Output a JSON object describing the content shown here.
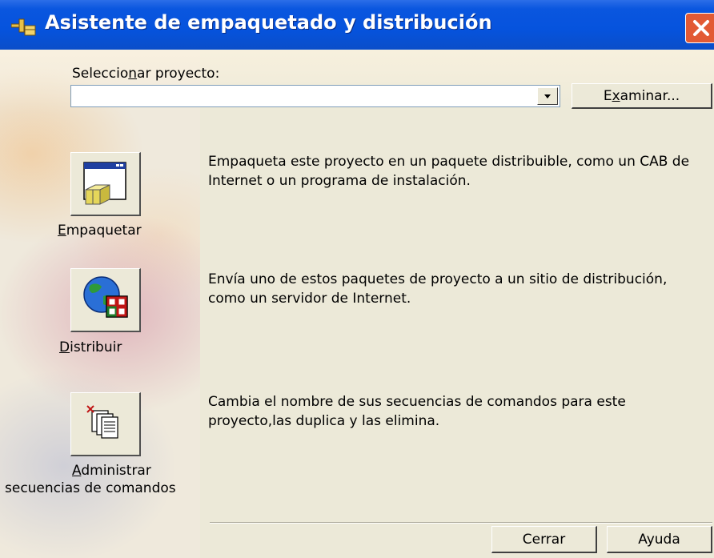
{
  "window": {
    "title": "Asistente de empaquetado y distribución",
    "close_icon": "close-icon",
    "accent_color": "#0653dd",
    "close_color": "#e25a34"
  },
  "project": {
    "label_pre": "Seleccio",
    "label_mnemonic": "n",
    "label_post": "ar proyecto:",
    "value": "",
    "browse_pre": "E",
    "browse_mnemonic": "x",
    "browse_post": "aminar..."
  },
  "actions": [
    {
      "icon": "package-icon",
      "caption_mnemonic": "E",
      "caption_post": "mpaquetar",
      "description": "Empaqueta este proyecto en un paquete distribuible, como un CAB de Internet o un programa de instalación."
    },
    {
      "icon": "globe-icon",
      "caption_mnemonic": "D",
      "caption_post": "istribuir",
      "description": "Envía uno de estos paquetes de proyecto a un sitio de distribución, como un servidor de Internet."
    },
    {
      "icon": "scripts-icon",
      "caption_mnemonic": "A",
      "caption_post": "dministrar",
      "caption_line2": "secuencias de comandos",
      "description": "Cambia el nombre de sus secuencias de comandos para este proyecto,las duplica y las elimina."
    }
  ],
  "footer": {
    "close_label": "Cerrar",
    "help_label": "Ayuda"
  }
}
